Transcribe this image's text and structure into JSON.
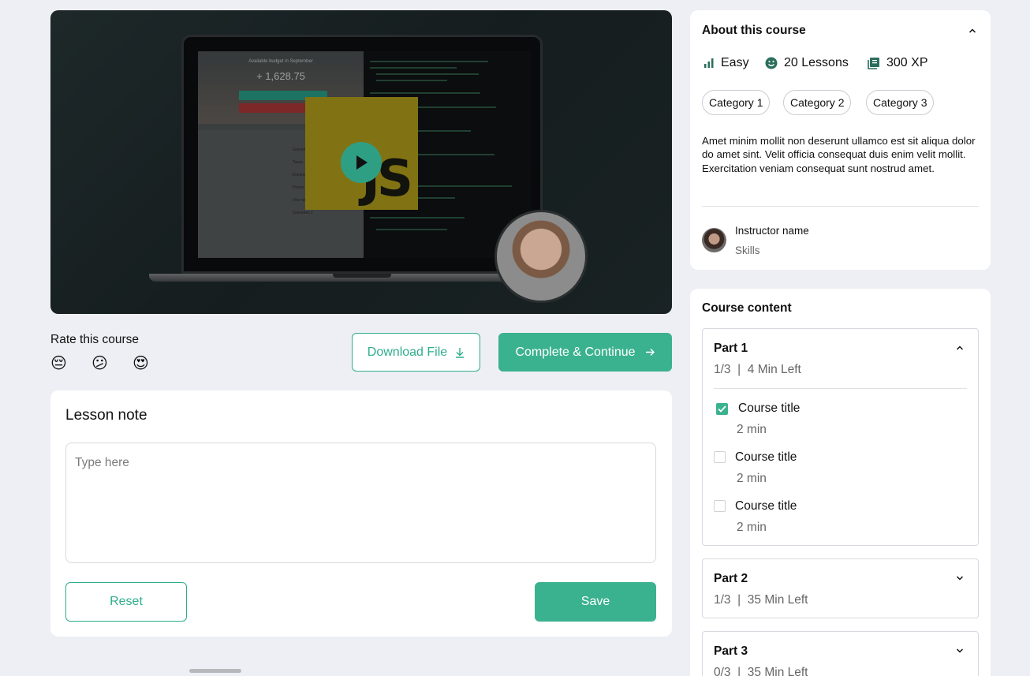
{
  "video": {
    "budget_label": "Available budget in September",
    "budget_amount": "+ 1,628.75",
    "logo_text": "JS",
    "list_rows": [
      "Groceries",
      "Taxes",
      "Electricity",
      "Phone bill",
      "One week travel",
      "Groceries 2"
    ]
  },
  "rating": {
    "title": "Rate this course",
    "emojis": [
      "😔",
      "😕",
      "😍"
    ]
  },
  "actions": {
    "download_label": "Download File",
    "complete_label": "Complete & Continue"
  },
  "lesson_note": {
    "title": "Lesson note",
    "placeholder": "Type here",
    "reset_label": "Reset",
    "save_label": "Save"
  },
  "about": {
    "title": "About this course",
    "level": "Easy",
    "lessons": "20 Lessons",
    "xp": "300 XP",
    "categories": [
      "Category 1",
      "Category 2",
      "Category 3"
    ],
    "description": "Amet minim mollit non deserunt ullamco est sit aliqua dolor do amet sint. Velit officia consequat duis enim velit mollit. Exercitation veniam consequat sunt nostrud amet.",
    "instructor_name": "Instructor name",
    "instructor_skills": "Skills"
  },
  "course_content": {
    "title": "Course content",
    "parts": [
      {
        "name": "Part 1",
        "meta": "1/3  |  4 Min Left",
        "expanded": true,
        "lessons": [
          {
            "title": "Course title",
            "duration": "2 min",
            "done": true
          },
          {
            "title": "Course title",
            "duration": "2 min",
            "done": false
          },
          {
            "title": "Course title",
            "duration": "2 min",
            "done": false
          }
        ]
      },
      {
        "name": "Part 2",
        "meta": "1/3  |  35 Min Left",
        "expanded": false
      },
      {
        "name": "Part 3",
        "meta": "0/3  |  35 Min Left",
        "expanded": false
      }
    ]
  },
  "colors": {
    "accent": "#3bb28f",
    "background": "#eeeff4"
  }
}
